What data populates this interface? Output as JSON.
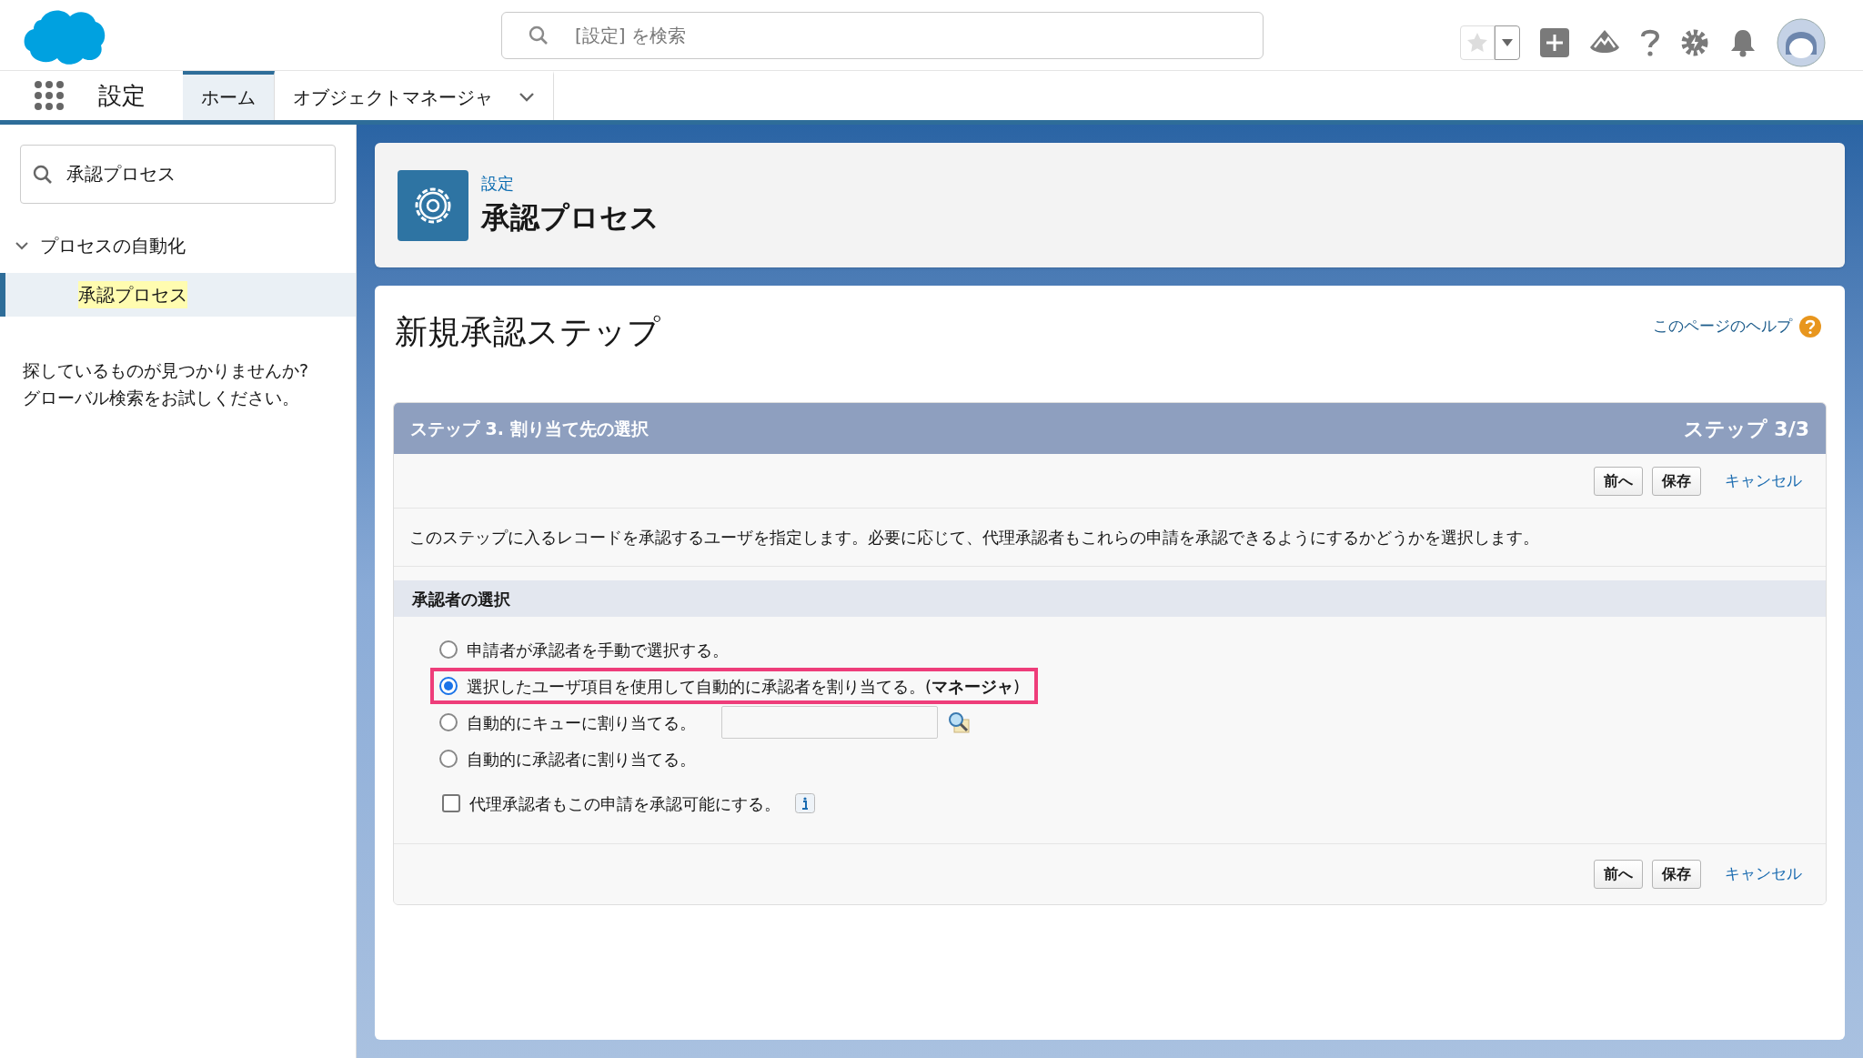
{
  "header": {
    "search": {
      "placeholder": "[設定] を検索"
    }
  },
  "nav": {
    "app_name": "設定",
    "tabs": [
      {
        "label": "ホーム",
        "selected": true,
        "has_menu": false
      },
      {
        "label": "オブジェクトマネージャ",
        "selected": false,
        "has_menu": true
      }
    ]
  },
  "sidebar": {
    "search": {
      "value": "承認プロセス"
    },
    "tree": [
      {
        "label": "プロセスの自動化",
        "expanded": true,
        "children": [
          {
            "label": "承認プロセス",
            "selected": true
          }
        ]
      }
    ],
    "hint": "探しているものが見つかりませんか?\nグローバル検索をお試しください。"
  },
  "page_header": {
    "breadcrumb": "設定",
    "title": "承認プロセス"
  },
  "content": {
    "title": "新規承認ステップ",
    "help_link": "このページのヘルプ",
    "step_bar": {
      "title": "ステップ 3. 割り当て先の選択",
      "counter": "ステップ 3/3"
    },
    "top_buttons": [
      "前へ",
      "保存"
    ],
    "top_cancel": "キャンセル",
    "description": "このステップに入るレコードを承認するユーザを指定します。必要に応じて、代理承認者もこれらの申請を承認できるようにするかどうかを選択します。",
    "section_title": "承認者の選択",
    "options": [
      {
        "label": "申請者が承認者を手動で選択する。",
        "selected": false,
        "highlighted": false,
        "kind": "plain"
      },
      {
        "label": "選択したユーザ項目を使用して自動的に承認者を割り当てる。(**マネージャ**)",
        "selected": true,
        "highlighted": true,
        "kind": "plain"
      },
      {
        "label": "自動的にキューに割り当てる。",
        "selected": false,
        "highlighted": false,
        "kind": "lookup"
      },
      {
        "label": "自動的に承認者に割り当てる。",
        "selected": false,
        "highlighted": false,
        "kind": "plain"
      }
    ],
    "delegate": {
      "label": "代理承認者もこの申請を承認可能にする。",
      "checked": false
    },
    "bottom_buttons": [
      "前へ",
      "保存"
    ],
    "bottom_cancel": "キャンセル"
  }
}
